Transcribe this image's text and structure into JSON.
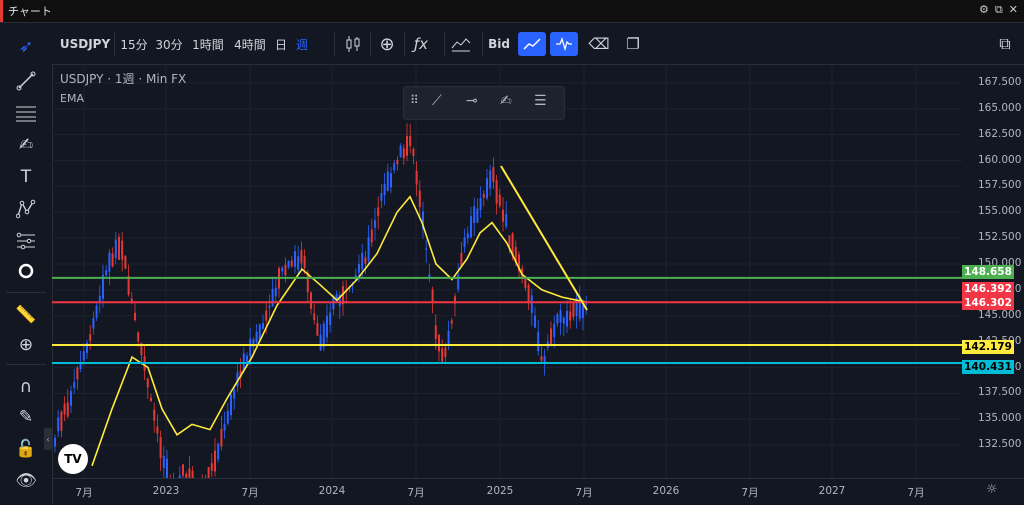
{
  "window": {
    "title": "チャート",
    "icons": [
      "gear-icon",
      "popout-icon",
      "close-icon"
    ]
  },
  "sidebar": {
    "tools": [
      "cursor-icon",
      "trendline-icon",
      "horizontal-lines-icon",
      "brush-icon",
      "text-icon",
      "pattern-icon",
      "prediction-icon",
      "circle-icon",
      "ruler-icon",
      "zoom-icon",
      "magnet-icon",
      "lock-draw-icon",
      "lock-icon",
      "eye-icon"
    ]
  },
  "toolbar": {
    "symbol": "USDJPY",
    "intervals": [
      "15分",
      "30分",
      "1時間",
      "4時間",
      "日",
      "週"
    ],
    "active_interval": "週",
    "bid_label": "Bid"
  },
  "legend": {
    "line1": "USDJPY · 1週 · Min FX",
    "line2": "EMA"
  },
  "price_axis": {
    "labels": [
      "167.500",
      "165.000",
      "162.500",
      "160.000",
      "157.500",
      "155.000",
      "152.500",
      "150.000",
      "147.500",
      "145.000",
      "142.500",
      "140.000",
      "137.500",
      "135.000",
      "132.500"
    ]
  },
  "price_tags": [
    {
      "value": "148.658",
      "color": "#4caf50"
    },
    {
      "value": "146.392",
      "color": "#f23645"
    },
    {
      "value": "146.302",
      "color": "#f23645"
    },
    {
      "value": "142.179",
      "color": "#ffeb3b"
    },
    {
      "value": "140.431",
      "color": "#00bcd4"
    }
  ],
  "time_axis": {
    "labels": [
      "7月",
      "2023",
      "7月",
      "2024",
      "7月",
      "2025",
      "7月",
      "2026",
      "7月",
      "2027",
      "7月"
    ]
  },
  "chart_data": {
    "type": "line",
    "title": "",
    "series_name": "",
    "x": [
      "2022-06",
      "2022-10",
      "2023-01",
      "2023-07",
      "2024-01",
      "2024-07",
      "2024-09",
      "2025-01",
      "2025-04",
      "2025-07"
    ],
    "values": [
      132.5,
      151.9,
      128.0,
      145.0,
      148.0,
      161.9,
      140.0,
      158.5,
      140.0,
      146.3
    ],
    "ema": [
      132.0,
      140.0,
      135.0,
      140.0,
      146.5,
      155.5,
      149.0,
      154.0,
      146.0,
      146.3
    ],
    "horizontal_lines": [
      {
        "value": 148.658,
        "color": "#4caf50"
      },
      {
        "value": 146.3,
        "color": "#f23645"
      },
      {
        "value": 142.179,
        "color": "#ffeb3b"
      },
      {
        "value": 140.431,
        "color": "#00bcd4"
      }
    ],
    "ylim": [
      130.0,
      169.0
    ]
  }
}
